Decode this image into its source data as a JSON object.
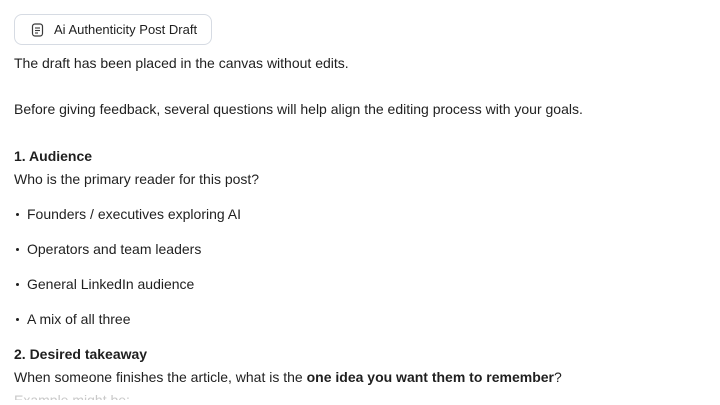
{
  "attachment": {
    "title": "Ai Authenticity Post Draft",
    "icon": "document-icon"
  },
  "message": {
    "intro": "The draft has been placed in the canvas without edits.",
    "lead": "Before giving feedback, several questions will help align the editing process with your goals.",
    "section1": {
      "heading": "1. Audience",
      "question": "Who is the primary reader for this post?",
      "options": [
        "Founders / executives exploring AI",
        "Operators and team leaders",
        "General LinkedIn audience",
        "A mix of all three"
      ]
    },
    "section2": {
      "heading": "2. Desired takeaway",
      "question_before": "When someone finishes the article, what is the ",
      "question_bold": "one idea you want them to remember",
      "question_after": "?",
      "next_line_partial": "Example might be:"
    }
  }
}
